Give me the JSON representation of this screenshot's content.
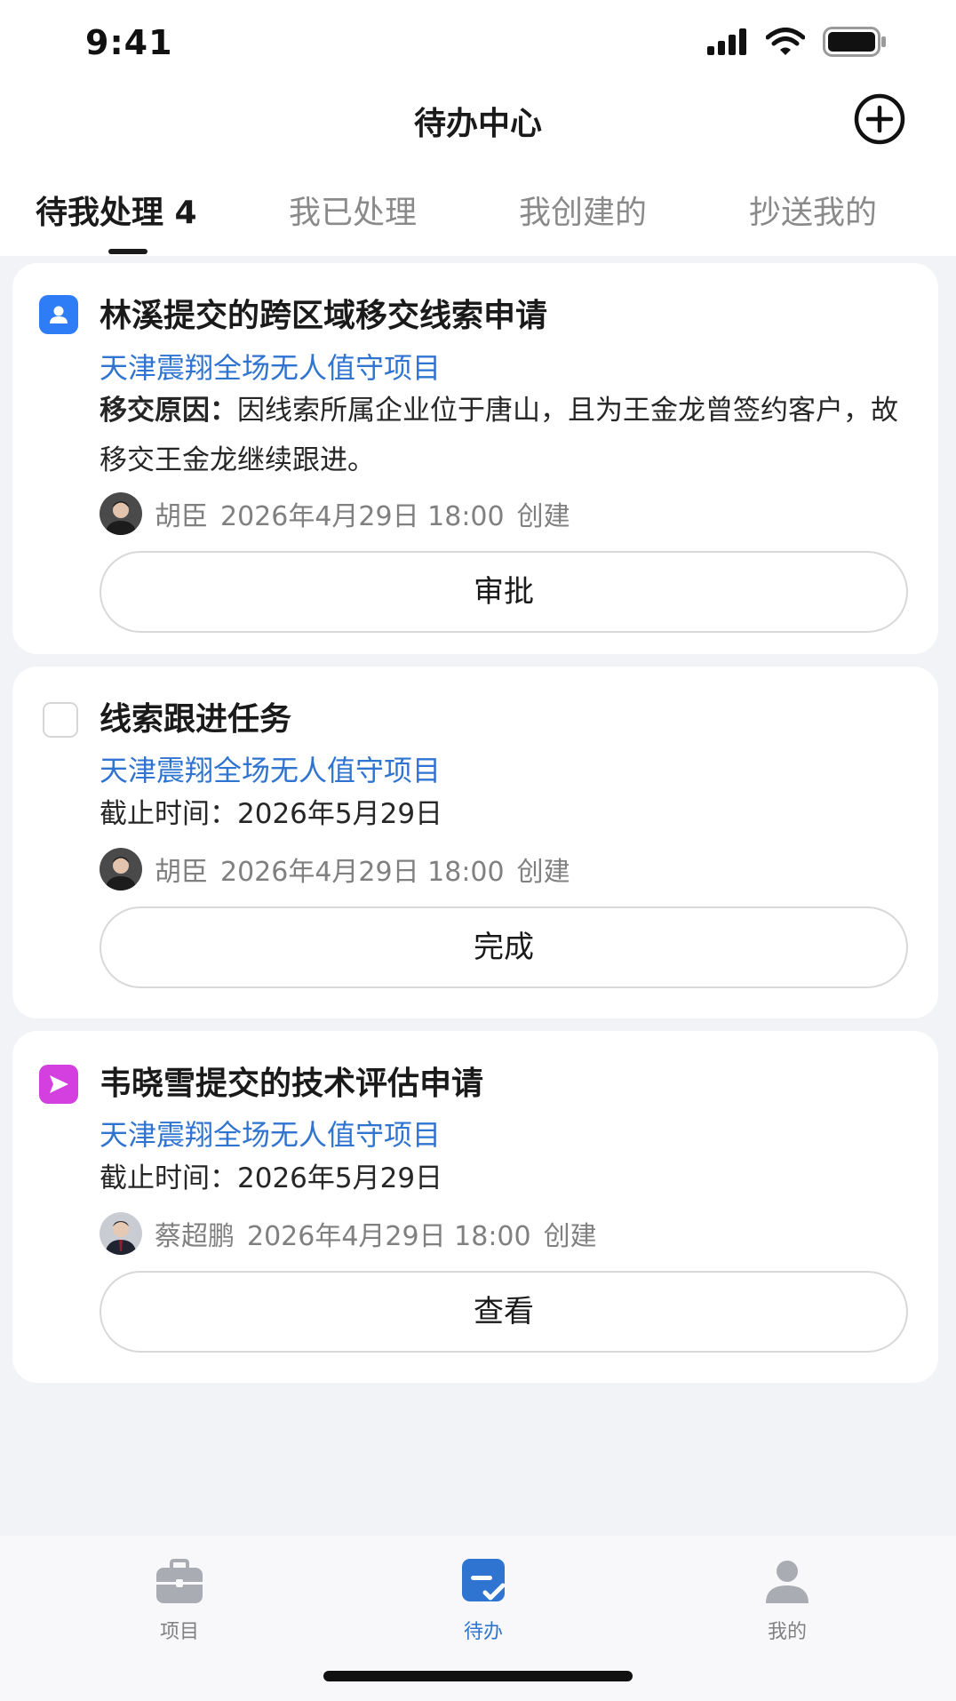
{
  "status_bar": {
    "time": "9:41"
  },
  "nav": {
    "title": "待办中心",
    "add_icon": "plus-circle-icon"
  },
  "tabs": [
    {
      "label": "待我处理 4",
      "active": true
    },
    {
      "label": "我已处理",
      "active": false
    },
    {
      "label": "我创建的",
      "active": false
    },
    {
      "label": "抄送我的",
      "active": false
    }
  ],
  "cards": [
    {
      "icon": "person-badge-icon",
      "title": "林溪提交的跨区域移交线索申请",
      "project": "天津震翔全场无人值守项目",
      "desc_label": "移交原因：",
      "desc_text": "因线索所属企业位于唐山，且为王金龙曾签约客户，故移交王金龙继续跟进。",
      "creator": "胡臣",
      "created_at": "2026年4月29日 18:00",
      "created_suffix": "创建",
      "button": "审批"
    },
    {
      "icon": "checkbox-icon",
      "title": "线索跟进任务",
      "project": "天津震翔全场无人值守项目",
      "desc_label": "截止时间：",
      "desc_text": "2026年5月29日",
      "creator": "胡臣",
      "created_at": "2026年4月29日 18:00",
      "created_suffix": "创建",
      "button": "完成"
    },
    {
      "icon": "send-arrow-icon",
      "title": "韦晓雪提交的技术评估申请",
      "project": "天津震翔全场无人值守项目",
      "desc_label": "截止时间：",
      "desc_text": "2026年5月29日",
      "creator": "蔡超鹏",
      "created_at": "2026年4月29日 18:00",
      "created_suffix": "创建",
      "button": "查看"
    }
  ],
  "tabbar": [
    {
      "label": "项目",
      "icon": "briefcase-icon",
      "active": false
    },
    {
      "label": "待办",
      "icon": "todo-check-icon",
      "active": true
    },
    {
      "label": "我的",
      "icon": "person-icon",
      "active": false
    }
  ],
  "colors": {
    "accent": "#2f74d0",
    "background": "#f2f3f7",
    "approval_icon": "#2f7df6",
    "send_icon": "#d43fe0"
  }
}
